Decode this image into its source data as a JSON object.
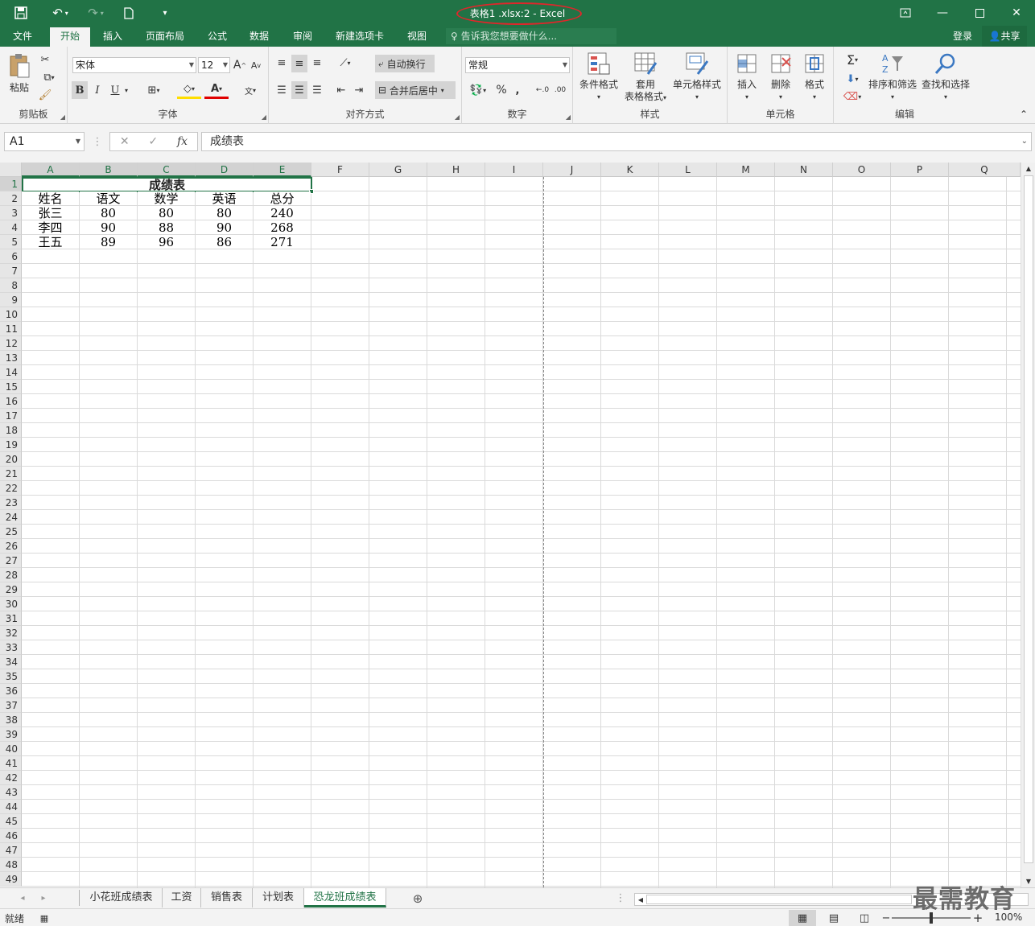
{
  "window": {
    "title": "表格1 .xlsx:2  -  Excel"
  },
  "quick_access": {
    "save_icon": "save-icon",
    "undo_icon": "undo-icon",
    "redo_icon": "redo-icon",
    "new_icon": "new-file-icon",
    "customize_icon": "customize-icon"
  },
  "ribbon_tabs": [
    "文件",
    "开始",
    "插入",
    "页面布局",
    "公式",
    "数据",
    "审阅",
    "新建选项卡",
    "视图"
  ],
  "tell_me": {
    "placeholder": "告诉我您想要做什么..."
  },
  "account": {
    "login": "登录",
    "share": "共享"
  },
  "ribbon": {
    "clipboard": {
      "label": "剪贴板",
      "paste": "粘贴"
    },
    "font": {
      "label": "字体",
      "family": "宋体",
      "size": "12",
      "bold": "B",
      "italic": "I",
      "underline": "U"
    },
    "alignment": {
      "label": "对齐方式",
      "wrap": "自动换行",
      "merge": "合并后居中"
    },
    "number": {
      "label": "数字",
      "format": "常规",
      "percent": "%",
      "comma": ","
    },
    "styles": {
      "label": "样式",
      "conditional": "条件格式",
      "table1": "套用",
      "table2": "表格格式",
      "cell_styles": "单元格样式"
    },
    "cells": {
      "label": "单元格",
      "insert": "插入",
      "delete": "删除",
      "format": "格式"
    },
    "editing": {
      "label": "编辑",
      "sort": "排序和筛选",
      "find": "查找和选择"
    }
  },
  "formula_bar": {
    "name_box": "A1",
    "content": "成绩表",
    "fx": "fx"
  },
  "columns": [
    "A",
    "B",
    "C",
    "D",
    "E",
    "F",
    "G",
    "H",
    "I",
    "J",
    "K",
    "L",
    "M",
    "N",
    "O",
    "P",
    "Q"
  ],
  "rows": [
    "1",
    "2",
    "3",
    "4",
    "5",
    "6",
    "7",
    "8",
    "9",
    "10",
    "11",
    "12",
    "13",
    "14",
    "15",
    "16",
    "17",
    "18",
    "19",
    "20",
    "21",
    "22",
    "23",
    "24",
    "25",
    "26",
    "27",
    "28",
    "29",
    "30",
    "31",
    "32",
    "33",
    "34",
    "35",
    "36",
    "37",
    "38",
    "39",
    "40",
    "41",
    "42",
    "43",
    "44",
    "45",
    "46",
    "47",
    "48",
    "49"
  ],
  "sheet": {
    "title": "成绩表",
    "header": [
      "姓名",
      "语文",
      "数学",
      "英语",
      "总分"
    ],
    "data": [
      [
        "张三",
        "80",
        "80",
        "80",
        "240"
      ],
      [
        "李四",
        "90",
        "88",
        "90",
        "268"
      ],
      [
        "王五",
        "89",
        "96",
        "86",
        "271"
      ]
    ]
  },
  "sheet_tabs": [
    "小花班成绩表",
    "工资",
    "销售表",
    "计划表",
    "恐龙班成绩表"
  ],
  "active_sheet_index": 4,
  "status": {
    "ready": "就绪",
    "zoom": "100%"
  },
  "watermark": "最需教育",
  "colors": {
    "excel_green": "#217346",
    "annotation_red": "#e0262b"
  }
}
